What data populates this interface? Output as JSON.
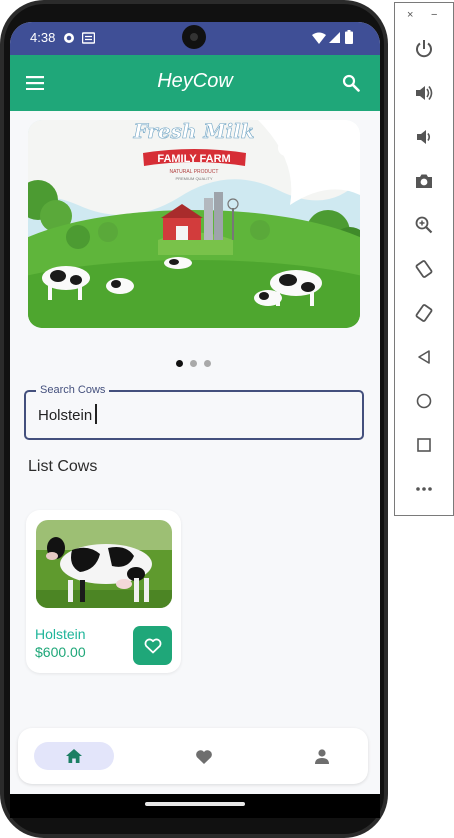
{
  "status_bar": {
    "time": "4:38"
  },
  "app_bar": {
    "title": "HeyCow"
  },
  "banner": {
    "headline": "Fresh Milk",
    "ribbon": "FAMILY FARM",
    "line1": "NATURAL PRODUCT",
    "line2": "PREMIUM QUALITY",
    "carousel_count": 3,
    "carousel_active": 0
  },
  "search": {
    "label": "Search Cows",
    "value": "Holstein"
  },
  "section_title": "List Cows",
  "cows": [
    {
      "name": "Holstein",
      "price": "$600.00"
    }
  ],
  "bottom_nav": {
    "items": [
      "home-icon",
      "heart-icon",
      "person-icon"
    ],
    "active": 0
  },
  "side_panel": {
    "close": "×",
    "minimize": "−"
  },
  "colors": {
    "primary": "#1fa779",
    "status_bar": "#3f4f96",
    "price_text": "#1fa779",
    "name_text": "#1fb59a"
  }
}
